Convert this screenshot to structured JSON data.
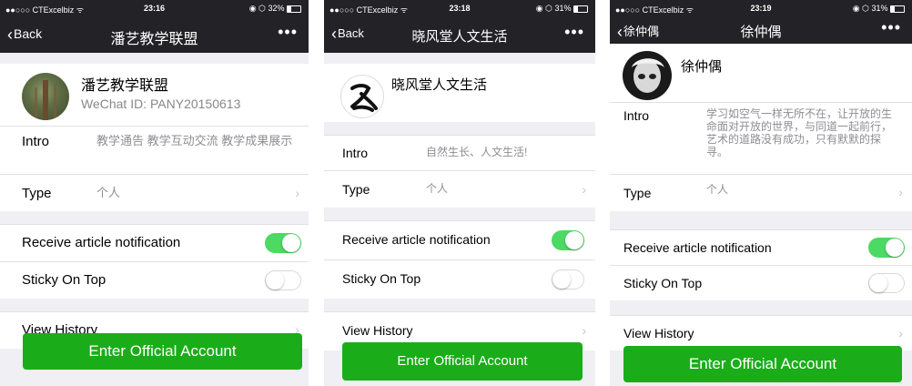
{
  "colors": {
    "nav_bg": "#232327",
    "toggle_on": "#4cd964",
    "button_green": "#1aad19",
    "page_bg": "#efeff4"
  },
  "screens": [
    {
      "status": {
        "carrier": "●●○○○ CTExcelbiz ᯤ",
        "time": "23:16",
        "battery": "◉ ⬡ 32%"
      },
      "nav": {
        "back_label": "Back",
        "title": "潘艺教学联盟",
        "more_icon": "•••"
      },
      "profile": {
        "name": "潘艺教学联盟",
        "wechat_id": "WeChat ID: PANY20150613"
      },
      "intro": {
        "label": "Intro",
        "value": "教学通告 教学互动交流 教学成果展示"
      },
      "type": {
        "label": "Type",
        "value": "个人"
      },
      "receive": {
        "label": "Receive article notification",
        "on": true
      },
      "sticky": {
        "label": "Sticky On Top",
        "on": false
      },
      "history": {
        "label": "View History"
      },
      "enter_button": "Enter Official Account"
    },
    {
      "status": {
        "carrier": "●●○○○ CTExcelbiz ᯤ",
        "time": "23:18",
        "battery": "◉ ⬡ 31%"
      },
      "nav": {
        "back_label": "Back",
        "title": "晓风堂人文生活",
        "more_icon": "•••"
      },
      "profile": {
        "name": "晓风堂人文生活"
      },
      "intro": {
        "label": "Intro",
        "value": "自然生长、人文生活!"
      },
      "type": {
        "label": "Type",
        "value": "个人"
      },
      "receive": {
        "label": "Receive article notification",
        "on": true
      },
      "sticky": {
        "label": "Sticky On Top",
        "on": false
      },
      "history": {
        "label": "View History"
      },
      "enter_button": "Enter Official Account"
    },
    {
      "status": {
        "carrier": "●●○○○ CTExcelbiz ᯤ",
        "time": "23:19",
        "battery": "◉ ⬡ 31%"
      },
      "nav": {
        "back_label": "徐仲偶",
        "title": "徐仲偶",
        "more_icon": "•••"
      },
      "profile": {
        "name": "徐仲偶"
      },
      "intro": {
        "label": "Intro",
        "value": "学习如空气一样无所不在，让开放的生命面对开放的世界，与同道一起前行，艺术的道路没有成功，只有默默的探寻。"
      },
      "type": {
        "label": "Type",
        "value": "个人"
      },
      "receive": {
        "label": "Receive article notification",
        "on": true
      },
      "sticky": {
        "label": "Sticky On Top",
        "on": false
      },
      "history": {
        "label": "View History"
      },
      "enter_button": "Enter Official Account"
    }
  ]
}
